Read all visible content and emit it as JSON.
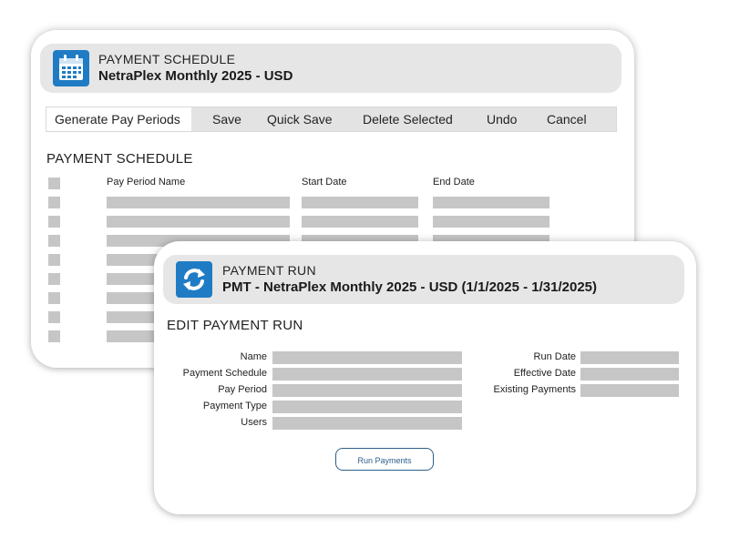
{
  "schedule_window": {
    "header": {
      "kicker": "PAYMENT SCHEDULE",
      "title": "NetraPlex Monthly 2025 - USD",
      "icon": "calendar-icon"
    },
    "toolbar": {
      "items": [
        "Generate Pay Periods",
        "Save",
        "Quick Save",
        "Delete Selected",
        "Undo",
        "Cancel"
      ],
      "active": "Generate Pay Periods"
    },
    "section_title": "PAYMENT SCHEDULE",
    "table": {
      "columns": [
        "Pay Period Name",
        "Start Date",
        "End Date"
      ],
      "row_count": 8
    }
  },
  "run_window": {
    "header": {
      "kicker": "PAYMENT RUN",
      "title": "PMT - NetraPlex Monthly 2025 - USD (1/1/2025 - 1/31/2025)",
      "icon": "refresh-icon"
    },
    "section_title": "EDIT PAYMENT RUN",
    "left_fields": [
      "Name",
      "Payment Schedule",
      "Pay Period",
      "Payment Type",
      "Users"
    ],
    "right_fields": [
      "Run Date",
      "Effective Date",
      "Existing Payments"
    ],
    "run_button": "Run Payments"
  },
  "colors": {
    "accent": "#1f7cc4",
    "header_bg": "#e6e6e6",
    "placeholder_bar": "#c6c6c6",
    "button_border": "#2d5f8a"
  }
}
